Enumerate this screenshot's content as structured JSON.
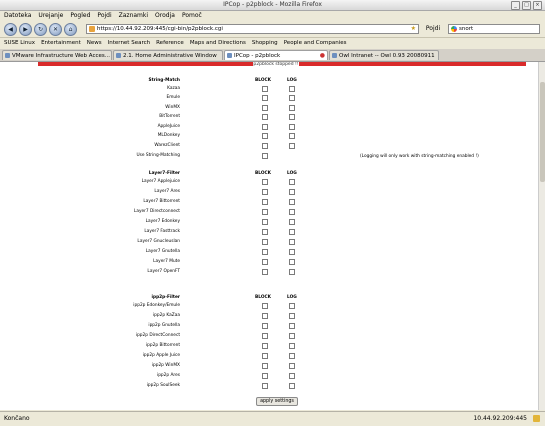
{
  "window": {
    "title": "IPCop - p2pblock - Mozilla Firefox"
  },
  "menu": [
    "Datoteka",
    "Urejanje",
    "Pogled",
    "Pojdi",
    "Zaznamki",
    "Orodja",
    "Pomoč"
  ],
  "nav": {
    "url": "https://10.44.92.209:445/cgi-bin/p2pblock.cgi",
    "go_label": "Pojdi",
    "search_value": "snort"
  },
  "bookmarks": [
    "SUSE Linux",
    "Entertainment",
    "News",
    "Internet Search",
    "Reference",
    "Maps and Directions",
    "Shopping",
    "People and Companies"
  ],
  "tabs": [
    "VMware Infrastructure Web Acces...",
    "2.1. Home Administrative Window",
    "IPCop - p2pblock",
    "Owl Intranet -- Owl 0.93 20080911"
  ],
  "page": {
    "header_tab": "p2pblock stopped !!",
    "col_block": "BLOCK",
    "col_log": "LOG",
    "string_match_heading": "String-Match",
    "string_match": [
      "Kazaa",
      "Emule",
      "WinMX",
      "BitTorrent",
      "AppleJuice",
      "MLDonkey",
      "WarezClient"
    ],
    "use_string_matching": "Use String-Matching",
    "logging_note": "(Logging will only work with string-matching enabled !)",
    "layer7_heading": "Layer7-Filter",
    "layer7": [
      "Layer7 Applejuice",
      "Layer7 Ares",
      "Layer7 Bittorrent",
      "Layer7 Directconnect",
      "Layer7 Edonkey",
      "Layer7 Fasttrack",
      "Layer7 Gnucleuslan",
      "Layer7 Gnutella",
      "Layer7 Mute",
      "Layer7 OpenFT"
    ],
    "ipp2p_heading": "ipp2p-Filter",
    "ipp2p": [
      "ipp2p Edonkey/Emule",
      "ipp2p KaZaa",
      "ipp2p Gnutella",
      "ipp2p DirectConnect",
      "ipp2p Bittorrent",
      "ipp2p Apple Juice",
      "ipp2p WinMX",
      "ipp2p Ares",
      "ipp2p SoulSeek"
    ],
    "apply_label": "apply settings"
  },
  "status": {
    "left": "Končano",
    "right": "10.44.92.209:445"
  }
}
